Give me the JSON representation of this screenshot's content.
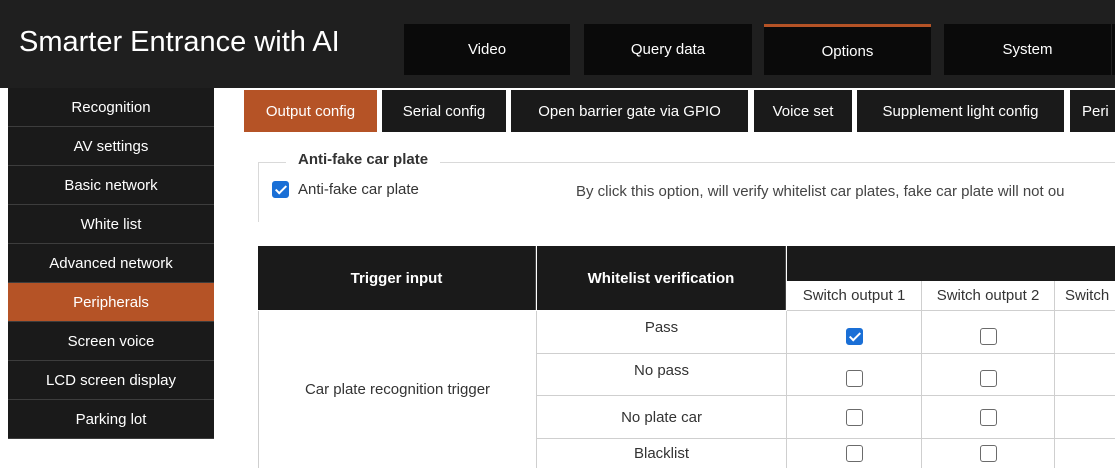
{
  "app": {
    "title": "Smarter Entrance with AI"
  },
  "top_nav": [
    "Video",
    "Query data",
    "Options",
    "System"
  ],
  "top_nav_active": "Options",
  "sidebar": {
    "items": [
      "Recognition",
      "AV settings",
      "Basic network",
      "White list",
      "Advanced network",
      "Peripherals",
      "Screen voice",
      "LCD screen display",
      "Parking lot"
    ],
    "active": "Peripherals"
  },
  "sub_tabs": [
    "Output config",
    "Serial config",
    "Open barrier gate via GPIO",
    "Voice set",
    "Supplement light config",
    "Peri"
  ],
  "sub_tabs_active": "Output config",
  "anti_fake": {
    "legend": "Anti-fake car plate",
    "checkbox_label": "Anti-fake car plate",
    "checked": true,
    "description": "By click this option, will verify whitelist car plates, fake car plate will not ou"
  },
  "table": {
    "headers": {
      "trigger_input": "Trigger input",
      "whitelist_verification": "Whitelist verification"
    },
    "switch_outputs": [
      "Switch output 1",
      "Switch output 2",
      "Switch"
    ],
    "trigger_name": "Car plate recognition trigger",
    "rows": [
      {
        "verification": "Pass",
        "switch1": true,
        "switch2": false
      },
      {
        "verification": "No pass",
        "switch1": false,
        "switch2": false
      },
      {
        "verification": "No plate car",
        "switch1": false,
        "switch2": false
      },
      {
        "verification": "Blacklist",
        "switch1": false,
        "switch2": false
      }
    ]
  },
  "colors": {
    "accent": "#b55326",
    "dark": "#1a1a1a",
    "checkbox_checked": "#1a6fd6"
  }
}
